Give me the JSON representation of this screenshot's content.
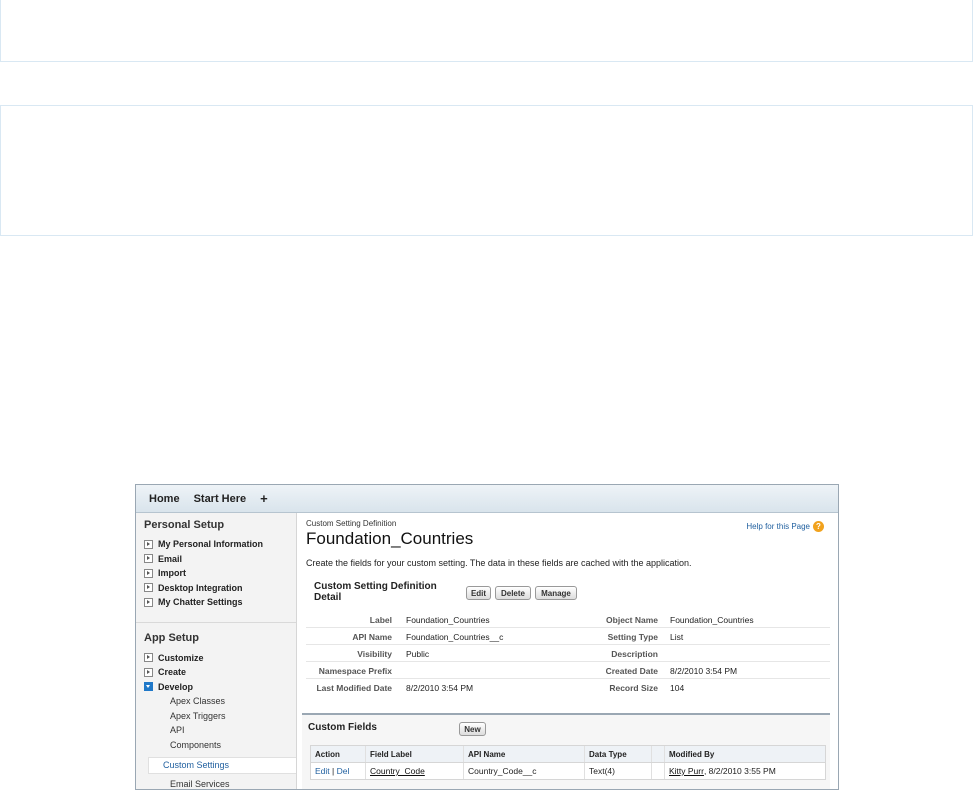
{
  "tabs": [
    "Home",
    "Start Here",
    "+"
  ],
  "sidebar": {
    "personal_title": "Personal Setup",
    "personal_items": [
      "My Personal Information",
      "Email",
      "Import",
      "Desktop Integration",
      "My Chatter Settings"
    ],
    "app_title": "App Setup",
    "app_items": [
      "Customize",
      "Create",
      "Develop"
    ],
    "develop_children": [
      "Apex Classes",
      "Apex Triggers",
      "API",
      "Components"
    ],
    "selected_item": "Custom Settings",
    "after_selected": "Email Services"
  },
  "main": {
    "breadcrumb": "Custom Setting Definition",
    "title": "Foundation_Countries",
    "help_link": "Help for this Page",
    "description": "Create the fields for your custom setting. The data in these fields are cached with the application.",
    "detail_title": "Custom Setting Definition Detail",
    "buttons": {
      "edit": "Edit",
      "delete": "Delete",
      "manage": "Manage"
    },
    "details": [
      {
        "label": "Label",
        "value": "Foundation_Countries",
        "label2": "Object Name",
        "value2": "Foundation_Countries"
      },
      {
        "label": "API Name",
        "value": "Foundation_Countries__c",
        "label2": "Setting Type",
        "value2": "List"
      },
      {
        "label": "Visibility",
        "value": "Public",
        "label2": "Description",
        "value2": ""
      },
      {
        "label": "Namespace Prefix",
        "value": "",
        "label2": "Created Date",
        "value2": "8/2/2010 3:54 PM"
      },
      {
        "label": "Last Modified Date",
        "value": "8/2/2010 3:54 PM",
        "label2": "Record Size",
        "value2": "104"
      }
    ]
  },
  "custom_fields": {
    "title": "Custom Fields",
    "new_button": "New",
    "headers": [
      "Action",
      "Field Label",
      "API Name",
      "Data Type",
      "Modified By"
    ],
    "row": {
      "edit": "Edit",
      "sep": "|",
      "del": "Del",
      "field_label": "Country_Code",
      "api_name": "Country_Code__c",
      "data_type": "Text(4)",
      "modified_by_user": "Kitty Purr",
      "modified_by_date": ", 8/2/2010 3:55 PM"
    }
  },
  "colors": {
    "link": "#1f5f9f",
    "help_icon": "#f1a21d",
    "develop_toggle": "#1f78c8"
  }
}
